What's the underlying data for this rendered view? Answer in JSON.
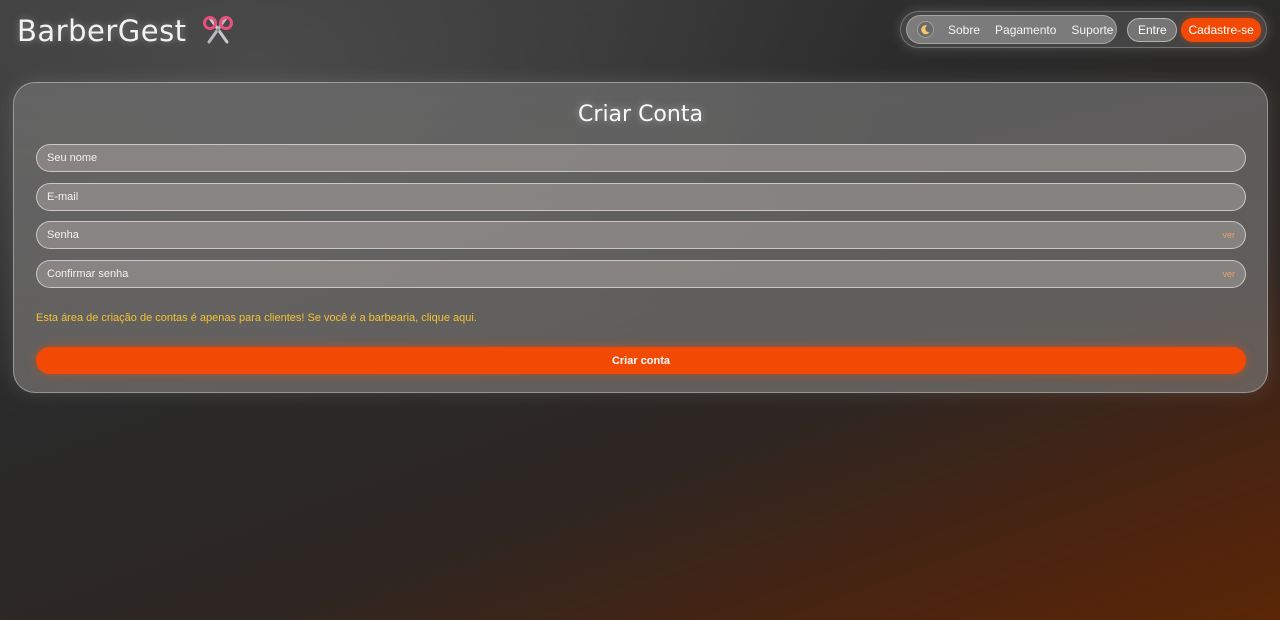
{
  "header": {
    "brand": "BarberGest",
    "brand_icon": "scissors-icon",
    "theme_icon": "moon-icon",
    "nav": [
      "Sobre",
      "Pagamento",
      "Suporte"
    ],
    "login_label": "Entre",
    "signup_label": "Cadastre-se"
  },
  "form": {
    "title": "Criar Conta",
    "fields": [
      {
        "placeholder": "Seu nome",
        "value": ""
      },
      {
        "placeholder": "E-mail",
        "value": ""
      },
      {
        "placeholder": "Senha",
        "value": "",
        "toggle": "ver"
      },
      {
        "placeholder": "Confirmar senha",
        "value": "",
        "toggle": "ver"
      }
    ],
    "notice": "Esta área de criação de contas é apenas para clientes! Se você é a barbearia, clique aqui.",
    "submit_label": "Criar conta"
  },
  "colors": {
    "accent": "#f24a06",
    "notice": "#f5c232",
    "toggle": "#e8a070"
  }
}
